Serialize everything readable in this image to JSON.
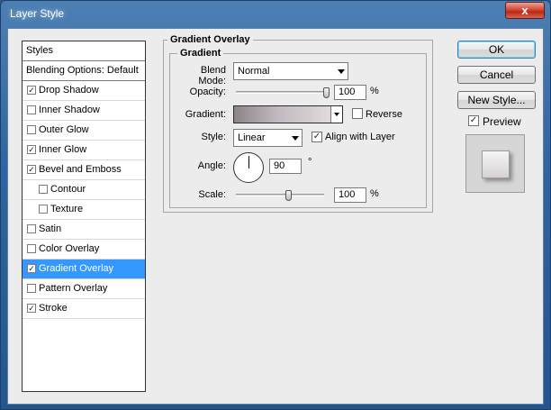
{
  "window": {
    "title": "Layer Style",
    "close_glyph": "x"
  },
  "styles_panel": {
    "header": "Styles",
    "blending": "Blending Options: Default",
    "items": [
      {
        "label": "Drop Shadow",
        "checked": true,
        "indent": false,
        "selected": false
      },
      {
        "label": "Inner Shadow",
        "checked": false,
        "indent": false,
        "selected": false
      },
      {
        "label": "Outer Glow",
        "checked": false,
        "indent": false,
        "selected": false
      },
      {
        "label": "Inner Glow",
        "checked": true,
        "indent": false,
        "selected": false
      },
      {
        "label": "Bevel and Emboss",
        "checked": true,
        "indent": false,
        "selected": false
      },
      {
        "label": "Contour",
        "checked": false,
        "indent": true,
        "selected": false
      },
      {
        "label": "Texture",
        "checked": false,
        "indent": true,
        "selected": false
      },
      {
        "label": "Satin",
        "checked": false,
        "indent": false,
        "selected": false
      },
      {
        "label": "Color Overlay",
        "checked": false,
        "indent": false,
        "selected": false
      },
      {
        "label": "Gradient Overlay",
        "checked": true,
        "indent": false,
        "selected": true
      },
      {
        "label": "Pattern Overlay",
        "checked": false,
        "indent": false,
        "selected": false
      },
      {
        "label": "Stroke",
        "checked": true,
        "indent": false,
        "selected": false
      }
    ]
  },
  "gradient_overlay": {
    "group_title": "Gradient Overlay",
    "subgroup_title": "Gradient",
    "blend_mode_label": "Blend Mode:",
    "blend_mode_value": "Normal",
    "opacity_label": "Opacity:",
    "opacity_value": "100",
    "opacity_unit": "%",
    "opacity_fraction": 1.0,
    "gradient_label": "Gradient:",
    "reverse_label": "Reverse",
    "reverse_checked": false,
    "style_label": "Style:",
    "style_value": "Linear",
    "align_label": "Align with Layer",
    "align_checked": true,
    "angle_label": "Angle:",
    "angle_value": "90",
    "angle_unit": "°",
    "scale_label": "Scale:",
    "scale_value": "100",
    "scale_unit": "%",
    "scale_fraction": 0.6
  },
  "buttons": {
    "ok": "OK",
    "cancel": "Cancel",
    "new_style": "New Style...",
    "preview_label": "Preview",
    "preview_checked": true
  },
  "colors": {
    "selection": "#3399ff",
    "gradient_start": "#8c8489",
    "gradient_end": "#e6e2e5"
  },
  "check_glyph": "✓"
}
